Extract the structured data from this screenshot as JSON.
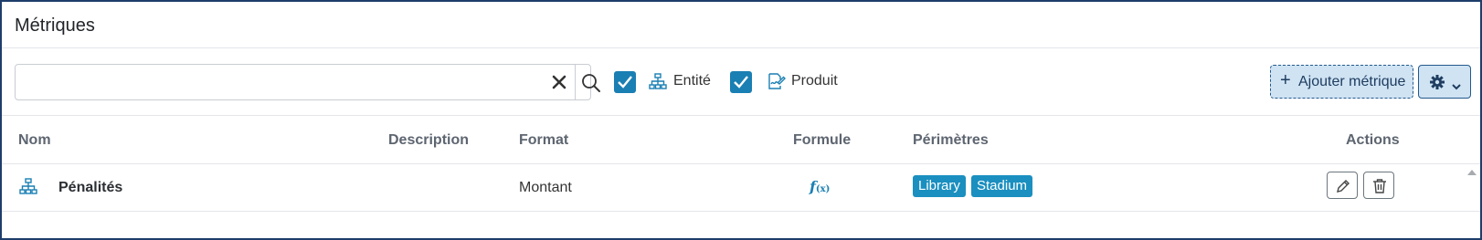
{
  "header": {
    "title": "Métriques"
  },
  "search": {
    "value": "",
    "placeholder": ""
  },
  "filters": [
    {
      "label": "Entité",
      "checked": true,
      "icon": "sitemap-icon"
    },
    {
      "label": "Produit",
      "checked": true,
      "icon": "signature-icon"
    }
  ],
  "toolbar": {
    "add_label": "Ajouter métrique",
    "add_icon": "plus-icon",
    "settings_icon": "gear-icon"
  },
  "table": {
    "columns": [
      "Nom",
      "Description",
      "Format",
      "Formule",
      "Périmètres",
      "Actions"
    ],
    "rows": [
      {
        "icon": "sitemap-icon",
        "name": "Pénalités",
        "description": "",
        "format": "Montant",
        "formula_icon": "function-icon",
        "formula_glyph": "f",
        "formula_sub": "(x)",
        "scopes": [
          "Library",
          "Stadium"
        ]
      }
    ]
  },
  "colors": {
    "accent": "#1a7fb3",
    "tag": "#1a8fc0",
    "frame": "#1e3d6b",
    "button_bg": "#cfe3f3"
  }
}
